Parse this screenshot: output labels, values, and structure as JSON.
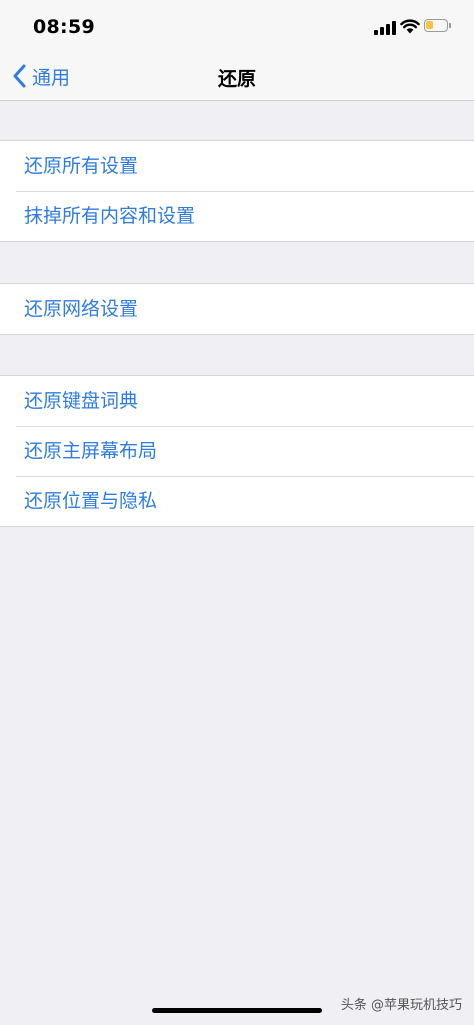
{
  "status_bar": {
    "time": "08:59",
    "battery_fill_fraction": 0.35,
    "battery_color": "#f4c544"
  },
  "nav": {
    "back_label": "通用",
    "title": "还原"
  },
  "groups": [
    {
      "items": [
        "还原所有设置",
        "抹掉所有内容和设置"
      ]
    },
    {
      "items": [
        "还原网络设置"
      ]
    },
    {
      "items": [
        "还原键盘词典",
        "还原主屏幕布局",
        "还原位置与隐私"
      ]
    }
  ],
  "watermark": {
    "text": "头条 @苹果玩机技巧"
  },
  "colors": {
    "accent": "#2f7ddf",
    "background": "#efeff4"
  }
}
